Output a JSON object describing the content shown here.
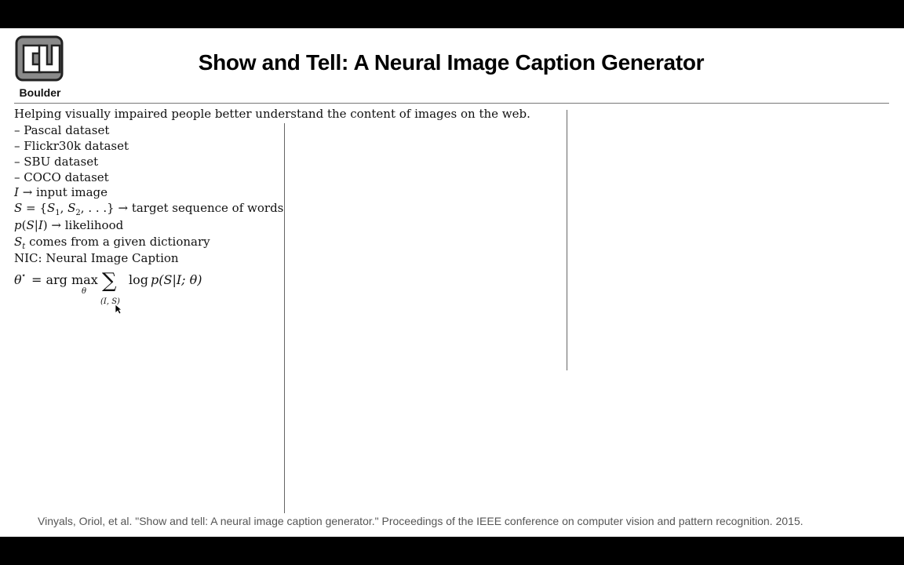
{
  "logo": {
    "text": "Boulder"
  },
  "title": "Show and Tell: A Neural Image Caption Generator",
  "intro": "Helping visually impaired people better understand the content of images on the web.",
  "datasets": [
    "– Pascal dataset",
    "– Flickr30k dataset",
    "– SBU dataset",
    "– COCO dataset"
  ],
  "notes": {
    "input": "→ input image",
    "target": "→ target sequence of words",
    "likelihood": "→ likelihood",
    "dictionary": "comes from a given dictionary",
    "nic": "NIC: Neural Image Caption"
  },
  "citation": "Vinyals, Oriol, et al. \"Show and tell: A neural image caption generator.\" Proceedings of the IEEE conference on computer vision and pattern recognition. 2015."
}
